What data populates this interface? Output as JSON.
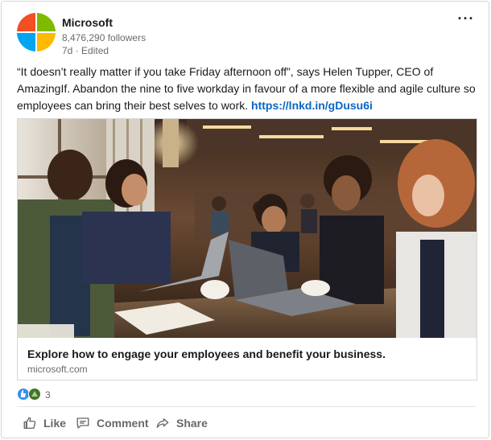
{
  "post": {
    "company_name": "Microsoft",
    "followers": "8,476,290 followers",
    "meta": "7d · Edited",
    "more_label": "···",
    "text_body": "“It doesn’t really matter if you take Friday afternoon off”, says Helen Tupper, CEO of AmazingIf. Abandon the nine to five workday in favour of a more flexible and agile culture so employees can bring their best selves to work.",
    "text_link": "https://lnkd.in/gDusu6i"
  },
  "article": {
    "title": "Explore how to engage your employees and benefit your business.",
    "domain": "microsoft.com"
  },
  "reactions": {
    "icons": [
      "like-icon",
      "celebrate-icon"
    ],
    "count": "3"
  },
  "actions": {
    "like_label": "Like",
    "comment_label": "Comment",
    "share_label": "Share"
  },
  "colors": {
    "link": "#0a66c2",
    "ms_red": "#f25022",
    "ms_green": "#7fba00",
    "ms_blue": "#00a4ef",
    "ms_yellow": "#ffb900"
  }
}
